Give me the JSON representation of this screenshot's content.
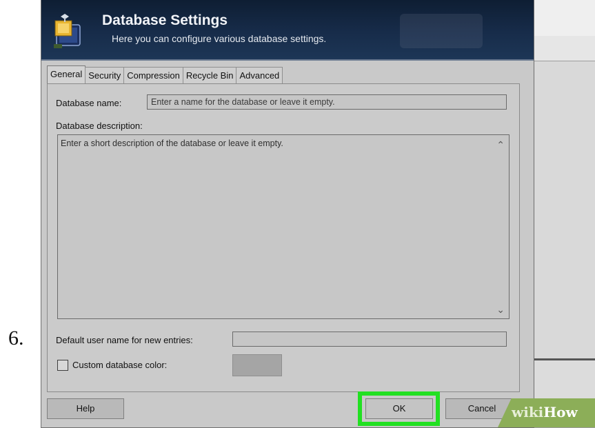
{
  "step_number": "6.",
  "dialog": {
    "title": "Database Settings",
    "subtitle": "Here you can configure various database settings.",
    "tabs": [
      "General",
      "Security",
      "Compression",
      "Recycle Bin",
      "Advanced"
    ],
    "active_tab": "General",
    "general": {
      "db_name_label": "Database name:",
      "db_name_placeholder": "Enter a name for the database or leave it empty.",
      "db_desc_label": "Database description:",
      "db_desc_placeholder": "Enter a short description of the database or leave it empty.",
      "default_user_label": "Default user name for new entries:",
      "default_user_value": "",
      "custom_color_label": "Custom database color:",
      "custom_color_checked": false,
      "custom_color_swatch": "#a5a5a5"
    },
    "buttons": {
      "help": "Help",
      "ok": "OK",
      "cancel": "Cancel"
    }
  },
  "highlight_color": "#22e022",
  "watermark": {
    "prefix": "wiki",
    "suffix": "How"
  },
  "icons": {
    "header_icon": "database-box-icon",
    "scroll_up": "chevron-up-icon",
    "scroll_down": "chevron-down-icon"
  }
}
